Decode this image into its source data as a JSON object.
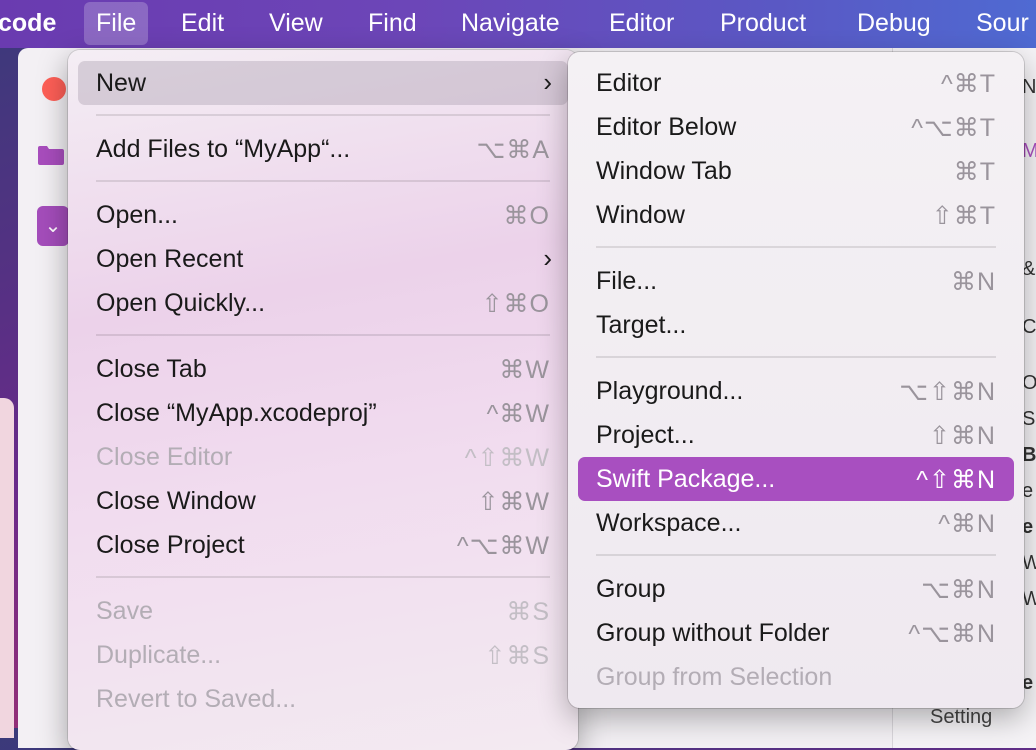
{
  "menubar": {
    "items": [
      "code",
      "File",
      "Edit",
      "View",
      "Find",
      "Navigate",
      "Editor",
      "Product",
      "Debug",
      "Sour"
    ]
  },
  "background": {
    "right_fragments": [
      "N",
      "M",
      "&",
      "C",
      "Or",
      "Sc",
      "B",
      "e",
      "e",
      "W",
      "W",
      "e"
    ],
    "setting_label": "Setting"
  },
  "file_menu": {
    "items": [
      {
        "label": "New",
        "shortcut": "",
        "submenu": true
      },
      {
        "label": "Add Files to “MyApp“...",
        "shortcut": "⌥⌘A"
      },
      {
        "label": "Open...",
        "shortcut": "⌘O"
      },
      {
        "label": "Open Recent",
        "shortcut": "",
        "submenu": true
      },
      {
        "label": "Open Quickly...",
        "shortcut": "⇧⌘O"
      },
      {
        "label": "Close Tab",
        "shortcut": "⌘W"
      },
      {
        "label": "Close “MyApp.xcodeproj”",
        "shortcut": "^⌘W"
      },
      {
        "label": "Close Editor",
        "shortcut": "^⇧⌘W",
        "disabled": true
      },
      {
        "label": "Close Window",
        "shortcut": "⇧⌘W"
      },
      {
        "label": "Close Project",
        "shortcut": "^⌥⌘W"
      },
      {
        "label": "Save",
        "shortcut": "⌘S",
        "disabled": true
      },
      {
        "label": "Duplicate...",
        "shortcut": "⇧⌘S",
        "disabled": true
      },
      {
        "label": "Revert to Saved...",
        "shortcut": "",
        "disabled": true
      }
    ]
  },
  "new_submenu": {
    "items": [
      {
        "label": "Editor",
        "shortcut": "^⌘T"
      },
      {
        "label": "Editor Below",
        "shortcut": "^⌥⌘T"
      },
      {
        "label": "Window Tab",
        "shortcut": "⌘T"
      },
      {
        "label": "Window",
        "shortcut": "⇧⌘T"
      },
      {
        "label": "File...",
        "shortcut": "⌘N"
      },
      {
        "label": "Target...",
        "shortcut": ""
      },
      {
        "label": "Playground...",
        "shortcut": "⌥⇧⌘N"
      },
      {
        "label": "Project...",
        "shortcut": "⇧⌘N"
      },
      {
        "label": "Swift Package...",
        "shortcut": "^⇧⌘N",
        "highlighted": true
      },
      {
        "label": "Workspace...",
        "shortcut": "^⌘N"
      },
      {
        "label": "Group",
        "shortcut": "⌥⌘N"
      },
      {
        "label": "Group without Folder",
        "shortcut": "^⌥⌘N"
      },
      {
        "label": "Group from Selection",
        "shortcut": "",
        "disabled": true
      }
    ]
  },
  "colors": {
    "highlight": "#a84fc0",
    "close_button": "#fe5f57"
  }
}
